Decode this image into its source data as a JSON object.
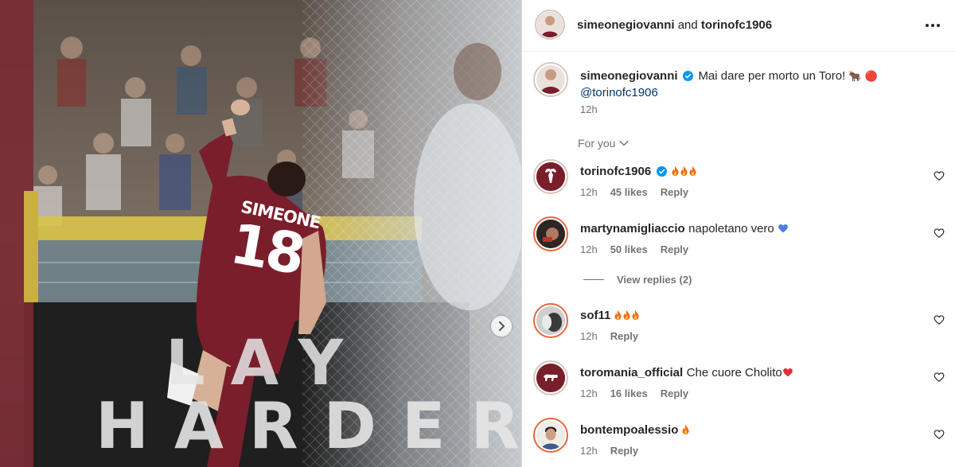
{
  "post": {
    "header": {
      "user1": "simeonegiovanni",
      "conjunction": "and",
      "user2": "torinofc1906"
    },
    "caption": {
      "username": "simeonegiovanni",
      "text": "Mai dare per morto un Toro! ",
      "emoji": "🐂 🔴",
      "mention": "@torinofc1906",
      "time": "12h"
    },
    "media": {
      "jersey_name": "SIMEONE",
      "jersey_number": "18",
      "board_line1": "LAY",
      "board_line2": "HARDER"
    },
    "sort_label": "For you",
    "view_replies": "View replies (2)",
    "reply_label": "Reply",
    "comments": [
      {
        "username": "torinofc1906",
        "text": "",
        "time": "12h",
        "likes": "45 likes"
      },
      {
        "username": "martynamigliaccio",
        "text": "napoletano vero",
        "time": "12h",
        "likes": "50 likes"
      },
      {
        "username": "sof11",
        "text": "",
        "time": "12h",
        "likes": ""
      },
      {
        "username": "toromania_official",
        "text": "Che cuore Cholito",
        "time": "12h",
        "likes": "16 likes"
      },
      {
        "username": "bontempoalessio",
        "text": "",
        "time": "12h",
        "likes": ""
      }
    ]
  },
  "colors": {
    "accent_blue": "#0095f6",
    "mention_blue": "#00376b",
    "club_maroon": "#7a1e2b",
    "text_primary": "#262626",
    "text_secondary": "#737373"
  }
}
